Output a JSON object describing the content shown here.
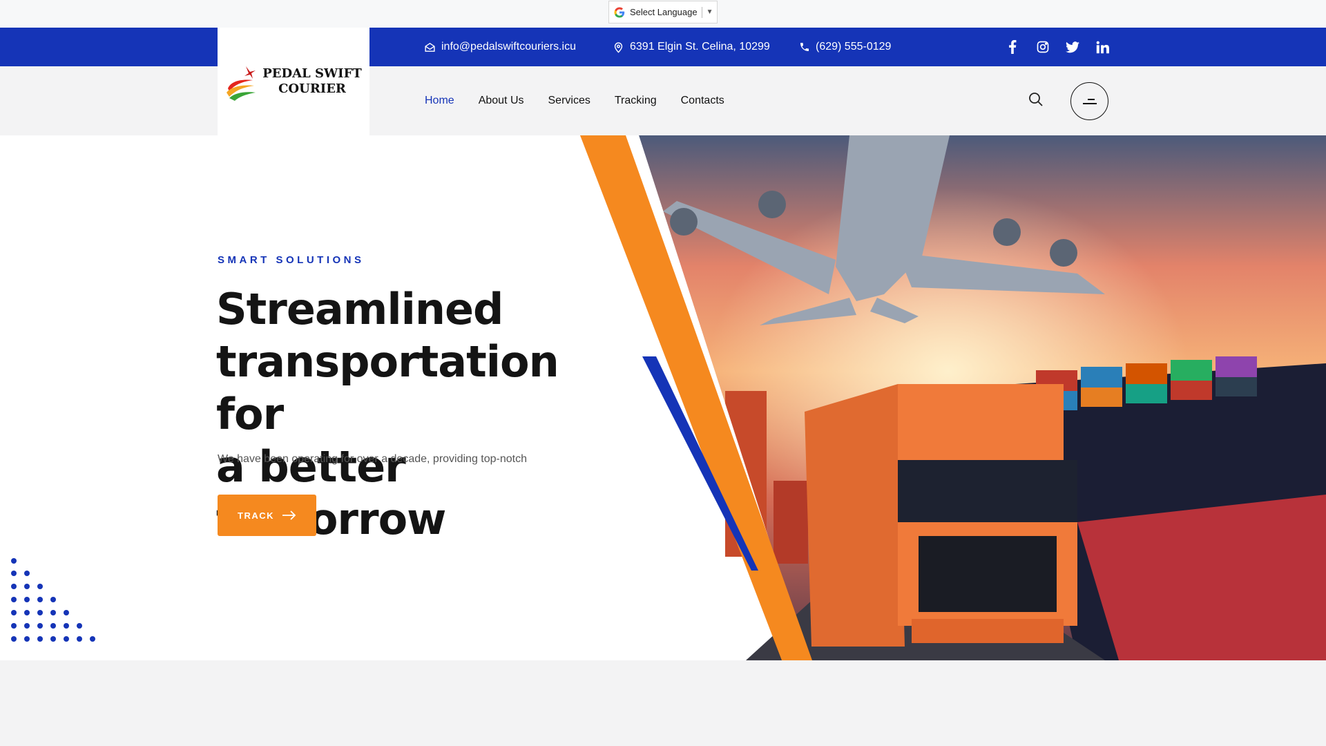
{
  "language": {
    "label": "Select Language",
    "arrow": "▼"
  },
  "contact": {
    "email": "info@pedalswiftcouriers.icu",
    "address": "6391 Elgin St. Celina, 10299",
    "phone": "(629) 555-0129"
  },
  "social": [
    "facebook-icon",
    "instagram-icon",
    "twitter-icon",
    "linkedin-icon"
  ],
  "logo": {
    "line1": "PEDAL SWIFT",
    "line2": "COURIER"
  },
  "nav": {
    "items": [
      {
        "label": "Home",
        "active": true
      },
      {
        "label": "About Us"
      },
      {
        "label": "Services"
      },
      {
        "label": "Tracking"
      },
      {
        "label": "Contacts"
      }
    ]
  },
  "hero": {
    "kicker": "SMART SOLUTIONS",
    "headline_line1": "Streamlined",
    "headline_line2": "transportation for",
    "headline_line3": "a better tomorrow",
    "subtitle": "We have been operating for over a decade, providing top-notch",
    "button_label": "TRACK"
  },
  "colors": {
    "brand_blue": "#1534b7",
    "accent_orange": "#f5891f",
    "text_dark": "#141414"
  }
}
